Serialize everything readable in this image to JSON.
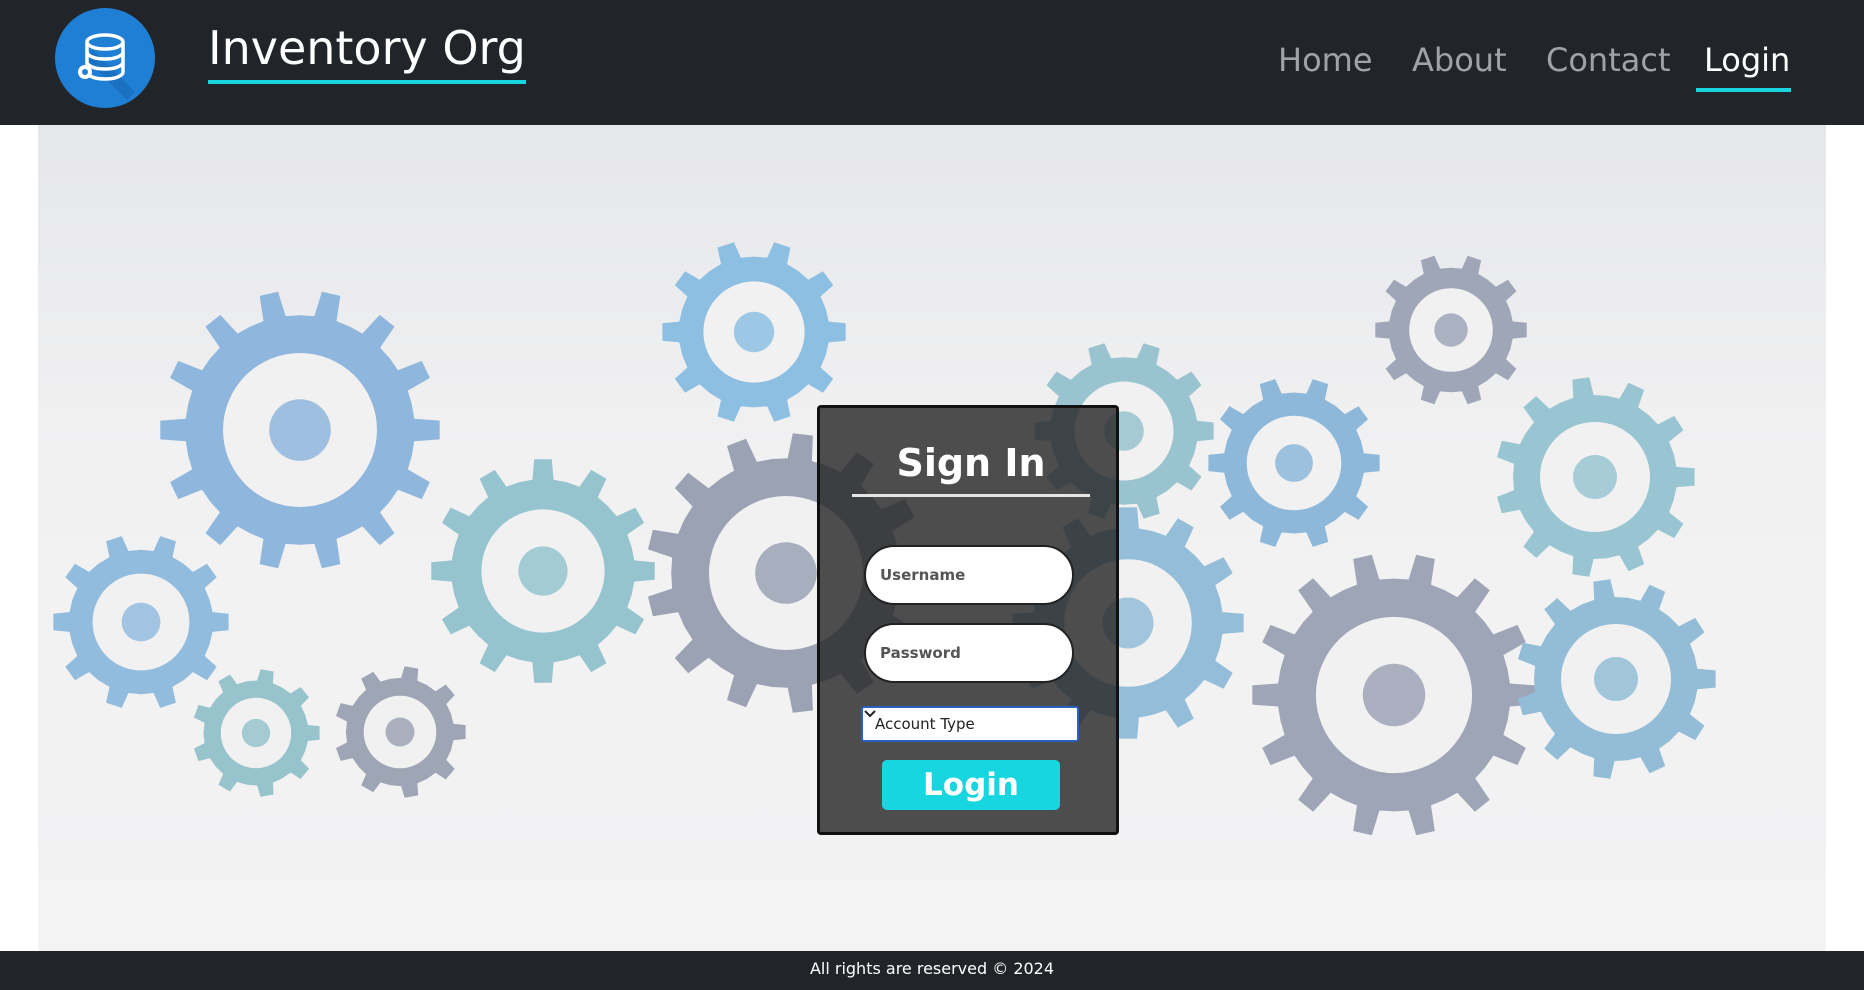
{
  "navbar": {
    "brand": "Inventory Org",
    "links": [
      {
        "label": "Home"
      },
      {
        "label": "About"
      },
      {
        "label": "Contact"
      },
      {
        "label": "Login"
      }
    ],
    "active": "Login"
  },
  "logo": {
    "icon": "database-gear-icon"
  },
  "signin": {
    "title": "Sign In",
    "username_placeholder": "Username",
    "password_placeholder": "Password",
    "account_type": "Account Type",
    "login_label": "Login"
  },
  "footer": {
    "text": "All rights are reserved © 2024"
  },
  "colors": {
    "navbar_bg": "#212529",
    "accent": "#17d6e0",
    "logo_blue": "#1f7fd4"
  }
}
